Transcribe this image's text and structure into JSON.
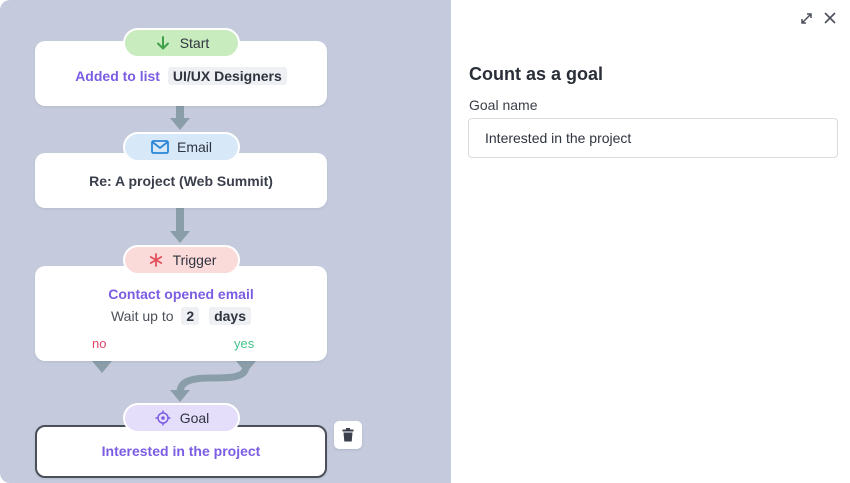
{
  "flow": {
    "start": {
      "pill_label": "Start",
      "icon": "arrow-down-icon",
      "text": "Added to list",
      "list_name": "UI/UX Designers"
    },
    "email": {
      "pill_label": "Email",
      "icon": "envelope-icon",
      "subject": "Re: A project (Web Summit)"
    },
    "trigger": {
      "pill_label": "Trigger",
      "icon": "asterisk-icon",
      "condition": "Contact opened email",
      "wait_prefix": "Wait up to",
      "wait_value": "2",
      "wait_unit": "days",
      "branch_no": "no",
      "branch_yes": "yes"
    },
    "goal": {
      "pill_label": "Goal",
      "icon": "target-icon",
      "name": "Interested in the project"
    },
    "delete_icon": "trash-icon"
  },
  "panel": {
    "title": "Count as a goal",
    "goal_name_label": "Goal name",
    "goal_name_value": "Interested in the project",
    "expand_icon": "expand-icon",
    "close_icon": "close-icon"
  },
  "colors": {
    "canvas_bg": "#c5cbdc",
    "accent_purple": "#7b5ce3",
    "start_green": "#c9ecbf",
    "email_blue": "#d7e8f8",
    "trigger_pink": "#fbdada",
    "goal_lavender": "#e4defb",
    "branch_no": "#e0466a",
    "branch_yes": "#43c38d",
    "connector": "#8a9eaa"
  }
}
